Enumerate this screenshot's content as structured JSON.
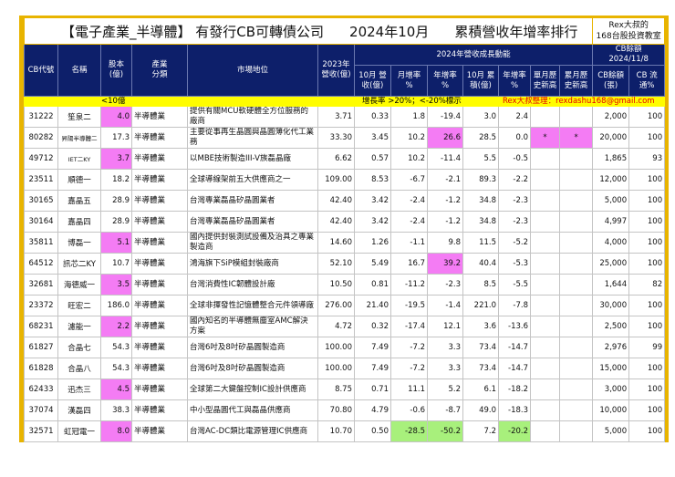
{
  "title": {
    "part1": "【電子產業_半導體】 有發行CB可轉債公司",
    "part2": "2024年10月",
    "part3": "累積營收年增率排行",
    "rex_line1": "Rex大叔的",
    "rex_line2": "168台股投資教室"
  },
  "headers": {
    "code": "CB代號",
    "name": "名稱",
    "capital": "股本 (億)",
    "industry": "產業 分類",
    "market": "市場地位",
    "rev2023": "2023年 營收(億)",
    "group2024": "2024年營收成長動能",
    "cb_group": "CB餘額 2024/11/8",
    "oct_rev": "10月 營收(億)",
    "mom": "月增率 %",
    "yoy": "年增率 %",
    "oct_cum": "10月 累積(億)",
    "cum_yoy": "年增率 %",
    "single_high": "單月歷 史新高",
    "cum_high": "累月歷 史新高",
    "cb_balance": "CB餘額 (張)",
    "cb_float": "CB 流通%"
  },
  "notes": {
    "small_cap": "<10億",
    "growth": "增長率 >20%；<-20%標示",
    "contact": "Rex大叔整理：rexdashu168@gmail.com"
  },
  "colors": {
    "highlight_magenta": "#f47cf4",
    "highlight_green": "#a8f07c",
    "header_navy": "#0d1f6a",
    "note_yellow": "#fffd00"
  },
  "rows": [
    {
      "code": "31222",
      "name": "笙泉二",
      "capital": "4.0",
      "industry": "半導體業",
      "market": "提供有關MCU軟硬體全方位服務的廠商",
      "rev2023": "3.71",
      "oct_rev": "0.33",
      "mom": "1.8",
      "yoy": "-19.4",
      "oct_cum": "3.0",
      "cum_yoy": "2.4",
      "single_high": "",
      "cum_high": "",
      "cb_balance": "2,000",
      "cb_float": "100",
      "hl": {
        "capital": "mag"
      }
    },
    {
      "code": "80282",
      "name": "昇陽半導體二",
      "capital": "17.3",
      "industry": "半導體業",
      "market": "主要從事再生晶圓與晶圓薄化代工業務",
      "rev2023": "33.30",
      "oct_rev": "3.45",
      "mom": "10.2",
      "yoy": "26.6",
      "oct_cum": "28.5",
      "cum_yoy": "0.0",
      "single_high": "*",
      "cum_high": "*",
      "cb_balance": "20,000",
      "cb_float": "100",
      "hl": {
        "yoy": "mag",
        "single_high": "mag",
        "cum_high": "mag"
      }
    },
    {
      "code": "49712",
      "name": "IET二KY",
      "capital": "3.7",
      "industry": "半導體業",
      "market": "以MBE技術製造III-V族磊晶廠",
      "rev2023": "6.62",
      "oct_rev": "0.57",
      "mom": "10.2",
      "yoy": "-11.4",
      "oct_cum": "5.5",
      "cum_yoy": "-0.5",
      "single_high": "",
      "cum_high": "",
      "cb_balance": "1,865",
      "cb_float": "93",
      "hl": {
        "capital": "mag"
      }
    },
    {
      "code": "23511",
      "name": "順德一",
      "capital": "18.2",
      "industry": "半導體業",
      "market": "全球導線架前五大供應商之一",
      "rev2023": "109.00",
      "oct_rev": "8.53",
      "mom": "-6.7",
      "yoy": "-2.1",
      "oct_cum": "89.3",
      "cum_yoy": "-2.2",
      "single_high": "",
      "cum_high": "",
      "cb_balance": "12,000",
      "cb_float": "100",
      "hl": {}
    },
    {
      "code": "30165",
      "name": "嘉晶五",
      "capital": "28.9",
      "industry": "半導體業",
      "market": "台灣專業磊晶矽晶圓業者",
      "rev2023": "42.40",
      "oct_rev": "3.42",
      "mom": "-2.4",
      "yoy": "-1.2",
      "oct_cum": "34.8",
      "cum_yoy": "-2.3",
      "single_high": "",
      "cum_high": "",
      "cb_balance": "5,000",
      "cb_float": "100",
      "hl": {}
    },
    {
      "code": "30164",
      "name": "嘉晶四",
      "capital": "28.9",
      "industry": "半導體業",
      "market": "台灣專業磊晶矽晶圓業者",
      "rev2023": "42.40",
      "oct_rev": "3.42",
      "mom": "-2.4",
      "yoy": "-1.2",
      "oct_cum": "34.8",
      "cum_yoy": "-2.3",
      "single_high": "",
      "cum_high": "",
      "cb_balance": "4,997",
      "cb_float": "100",
      "hl": {}
    },
    {
      "code": "35811",
      "name": "博磊一",
      "capital": "5.1",
      "industry": "半導體業",
      "market": "國內提供封裝測試設備及治具之專業製造商",
      "rev2023": "14.60",
      "oct_rev": "1.26",
      "mom": "-1.1",
      "yoy": "9.8",
      "oct_cum": "11.5",
      "cum_yoy": "-5.2",
      "single_high": "",
      "cum_high": "",
      "cb_balance": "4,000",
      "cb_float": "100",
      "hl": {
        "capital": "mag"
      }
    },
    {
      "code": "64512",
      "name": "訊芯二KY",
      "capital": "10.7",
      "industry": "半導體業",
      "market": "鴻海旗下SiP模組封裝廠商",
      "rev2023": "52.10",
      "oct_rev": "5.49",
      "mom": "16.7",
      "yoy": "39.2",
      "oct_cum": "40.4",
      "cum_yoy": "-5.3",
      "single_high": "",
      "cum_high": "",
      "cb_balance": "25,000",
      "cb_float": "100",
      "hl": {
        "yoy": "mag"
      }
    },
    {
      "code": "32681",
      "name": "海德威一",
      "capital": "3.5",
      "industry": "半導體業",
      "market": "台灣消費性IC韌體設計廠",
      "rev2023": "10.50",
      "oct_rev": "0.81",
      "mom": "-11.2",
      "yoy": "-2.3",
      "oct_cum": "8.5",
      "cum_yoy": "-5.5",
      "single_high": "",
      "cum_high": "",
      "cb_balance": "1,644",
      "cb_float": "82",
      "hl": {
        "capital": "mag"
      }
    },
    {
      "code": "23372",
      "name": "旺宏二",
      "capital": "186.0",
      "industry": "半導體業",
      "market": "全球非揮發性記憶體整合元件領導廠",
      "rev2023": "276.00",
      "oct_rev": "21.40",
      "mom": "-19.5",
      "yoy": "-1.4",
      "oct_cum": "221.0",
      "cum_yoy": "-7.8",
      "single_high": "",
      "cum_high": "",
      "cb_balance": "30,000",
      "cb_float": "100",
      "hl": {}
    },
    {
      "code": "68231",
      "name": "濾能一",
      "capital": "2.2",
      "industry": "半導體業",
      "market": "國內知名的半導體無塵室AMC解決方案",
      "rev2023": "4.72",
      "oct_rev": "0.32",
      "mom": "-17.4",
      "yoy": "12.1",
      "oct_cum": "3.6",
      "cum_yoy": "-13.6",
      "single_high": "",
      "cum_high": "",
      "cb_balance": "2,500",
      "cb_float": "100",
      "hl": {
        "capital": "mag"
      }
    },
    {
      "code": "61827",
      "name": "合晶七",
      "capital": "54.3",
      "industry": "半導體業",
      "market": "台灣6吋及8吋矽晶圓製造商",
      "rev2023": "100.00",
      "oct_rev": "7.49",
      "mom": "-7.2",
      "yoy": "3.3",
      "oct_cum": "73.4",
      "cum_yoy": "-14.7",
      "single_high": "",
      "cum_high": "",
      "cb_balance": "2,976",
      "cb_float": "99",
      "hl": {}
    },
    {
      "code": "61828",
      "name": "合晶八",
      "capital": "54.3",
      "industry": "半導體業",
      "market": "台灣6吋及8吋矽晶圓製造商",
      "rev2023": "100.00",
      "oct_rev": "7.49",
      "mom": "-7.2",
      "yoy": "3.3",
      "oct_cum": "73.4",
      "cum_yoy": "-14.7",
      "single_high": "",
      "cum_high": "",
      "cb_balance": "15,000",
      "cb_float": "100",
      "hl": {}
    },
    {
      "code": "62433",
      "name": "迅杰三",
      "capital": "4.5",
      "industry": "半導體業",
      "market": "全球第二大鍵盤控制IC設計供應商",
      "rev2023": "8.75",
      "oct_rev": "0.71",
      "mom": "11.1",
      "yoy": "5.2",
      "oct_cum": "6.1",
      "cum_yoy": "-18.2",
      "single_high": "",
      "cum_high": "",
      "cb_balance": "3,000",
      "cb_float": "100",
      "hl": {
        "capital": "mag"
      }
    },
    {
      "code": "37074",
      "name": "漢磊四",
      "capital": "38.3",
      "industry": "半導體業",
      "market": "中小型晶圓代工與磊晶供應商",
      "rev2023": "70.80",
      "oct_rev": "4.79",
      "mom": "-0.6",
      "yoy": "-8.7",
      "oct_cum": "49.0",
      "cum_yoy": "-18.3",
      "single_high": "",
      "cum_high": "",
      "cb_balance": "10,000",
      "cb_float": "100",
      "hl": {}
    },
    {
      "code": "32571",
      "name": "虹冠電一",
      "capital": "8.0",
      "industry": "半導體業",
      "market": "台灣AC-DC類比電源管理IC供應商",
      "rev2023": "10.70",
      "oct_rev": "0.50",
      "mom": "-28.5",
      "yoy": "-50.2",
      "oct_cum": "7.2",
      "cum_yoy": "-20.2",
      "single_high": "",
      "cum_high": "",
      "cb_balance": "5,000",
      "cb_float": "100",
      "hl": {
        "capital": "mag",
        "mom": "grn",
        "yoy": "grn",
        "cum_yoy": "grn"
      }
    }
  ]
}
